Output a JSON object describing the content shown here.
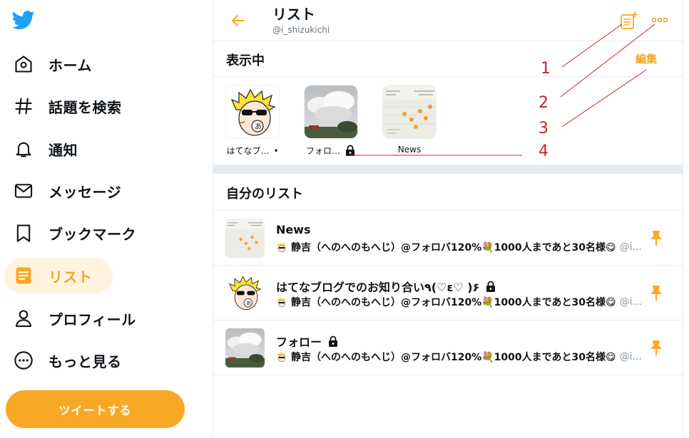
{
  "colors": {
    "accent": "#f9a825",
    "accent_light": "#fff3df",
    "text": "#0f1419",
    "muted": "#657786",
    "annotation": "#d42020"
  },
  "sidebar": {
    "logo_icon": "bird-icon",
    "items": [
      {
        "label": "ホーム",
        "icon": "home-icon"
      },
      {
        "label": "話題を検索",
        "icon": "hashtag-icon"
      },
      {
        "label": "通知",
        "icon": "bell-icon"
      },
      {
        "label": "メッセージ",
        "icon": "mail-icon"
      },
      {
        "label": "ブックマーク",
        "icon": "bookmark-icon"
      },
      {
        "label": "リスト",
        "icon": "list-icon",
        "active": true
      },
      {
        "label": "プロフィール",
        "icon": "person-icon"
      },
      {
        "label": "もっと見る",
        "icon": "more-circle-icon"
      }
    ],
    "tweet_button": "ツイートする"
  },
  "header": {
    "title": "リスト",
    "handle": "@i_shizukichi"
  },
  "pinned": {
    "title": "表示中",
    "edit_label": "編集",
    "items": [
      {
        "label": "はてなブ…",
        "suffix": "•"
      },
      {
        "label": "フォロ…",
        "locked": true
      },
      {
        "label": "News"
      }
    ]
  },
  "my_lists": {
    "title": "自分のリスト",
    "rows": [
      {
        "name": "News",
        "locked": false,
        "owner": "静吉（へのへのもへじ）@フォロバ120%💐1000人まであと30名様😋",
        "handle": "@i..."
      },
      {
        "name": "はてなブログでのお知り合い٩(♡ε♡ )۶",
        "locked": true,
        "owner": "静吉（へのへのもへじ）@フォロバ120%💐1000人まであと30名様😋",
        "handle": "@i..."
      },
      {
        "name": "フォロー",
        "locked": true,
        "owner": "静吉（へのへのもへじ）@フォロバ120%💐1000人まであと30名様😋",
        "handle": "@i..."
      }
    ]
  },
  "annotations": [
    "1",
    "2",
    "3",
    "4"
  ]
}
